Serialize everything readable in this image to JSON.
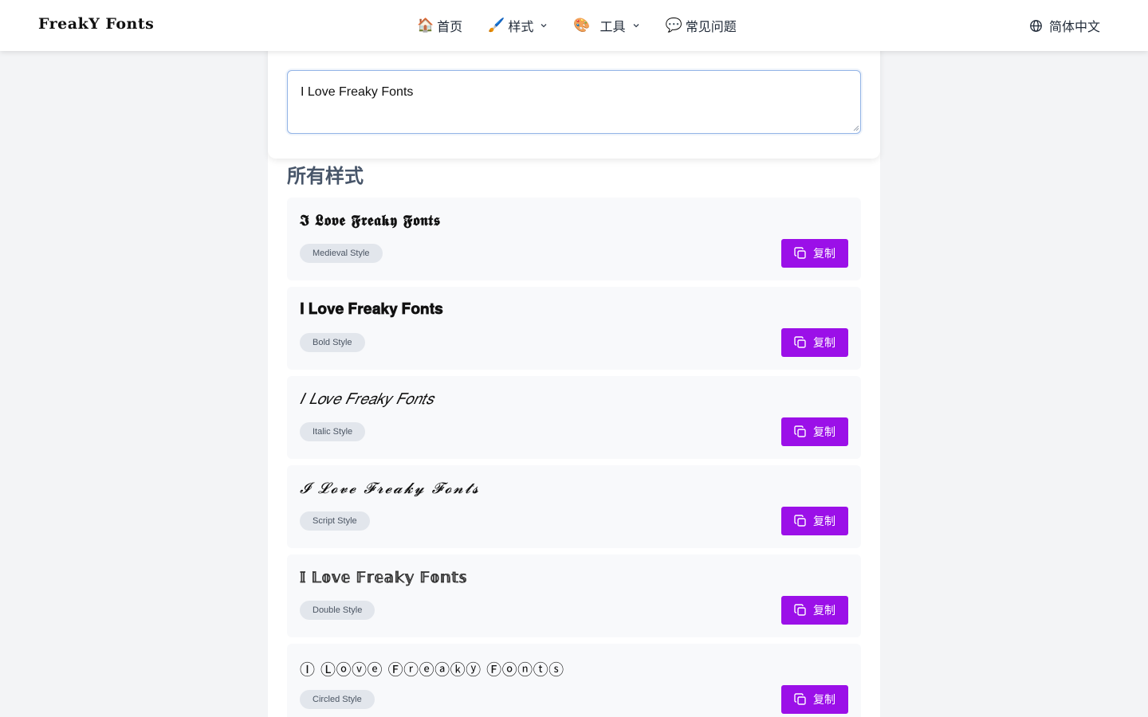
{
  "header": {
    "logo": "FreakY Fonts",
    "nav": [
      {
        "icon": "house-emoji",
        "emoji": "🏠",
        "label": "首页",
        "dropdown": false
      },
      {
        "icon": "paintbrush-emoji",
        "emoji": "🖌️",
        "label": "样式",
        "dropdown": true
      },
      {
        "icon": "palette-emoji",
        "emoji": "🎨",
        "label": "工具",
        "dropdown": true
      },
      {
        "icon": "speech-bubble-emoji",
        "emoji": "💬",
        "label": "常见问题",
        "dropdown": false
      }
    ],
    "language": "简体中文"
  },
  "input": {
    "value": "I Love Freaky Fonts"
  },
  "styles_section": {
    "title": "所有样式",
    "copy_label": "复制",
    "items": [
      {
        "text": "𝕴 𝕷𝖔𝖛𝖊 𝕱𝖗𝖊𝖆𝖐𝖞 𝕱𝖔𝖓𝖙𝖘",
        "badge": "Medieval Style"
      },
      {
        "text": "𝐈 𝐋𝐨𝐯𝐞 𝐅𝐫𝐞𝐚𝐤𝐲 𝐅𝐨𝐧𝐭𝐬",
        "badge": "Bold Style"
      },
      {
        "text": "𝐼 𝐿𝑜𝑣𝑒 𝐹𝑟𝑒𝑎𝑘𝑦 𝐹𝑜𝑛𝑡𝑠",
        "badge": "Italic Style"
      },
      {
        "text": "𝓘 𝓛𝓸𝓿𝓮 𝓕𝓻𝓮𝓪𝓴𝔂 𝓕𝓸𝓷𝓽𝓼",
        "badge": "Script Style"
      },
      {
        "text": "𝕀 𝕃𝕠𝕧𝕖 𝔽𝕣𝕖𝕒𝕜𝕪 𝔽𝕠𝕟𝕥𝕤",
        "badge": "Double Style"
      },
      {
        "text": "Ⓘ Ⓛⓞⓥⓔ Ⓕⓡⓔⓐⓚⓨ Ⓕⓞⓝⓣⓢ",
        "badge": "Circled Style"
      }
    ]
  },
  "colors": {
    "accent": "#9b10e8",
    "badge_bg": "#e2e6ec",
    "card_bg": "#f8f9fb",
    "page_bg": "#f3f4f6"
  }
}
